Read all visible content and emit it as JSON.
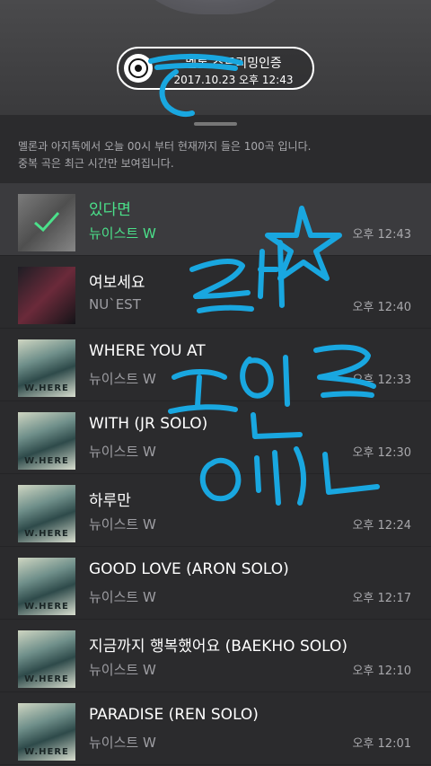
{
  "badge": {
    "title": "멜론 스트리밍인증",
    "date": "2017.10.23 오후 12:43"
  },
  "notice": {
    "line1": "멜론과 아지톡에서 오늘 00시 부터 현재까지 들은 100곡 입니다.",
    "line2": "중복 곡은 최근 시간만 보여집니다."
  },
  "songs": [
    {
      "title": "있다면",
      "artist": "뉴이스트 W",
      "time": "오후 12:43"
    },
    {
      "title": "여보세요",
      "artist": "NU`EST",
      "time": "오후 12:40"
    },
    {
      "title": "WHERE YOU AT",
      "artist": "뉴이스트 W",
      "time": "오후 12:33"
    },
    {
      "title": "WITH (JR SOLO)",
      "artist": "뉴이스트 W",
      "time": "오후 12:30"
    },
    {
      "title": "하루만",
      "artist": "뉴이스트 W",
      "time": "오후 12:24"
    },
    {
      "title": "GOOD LOVE (ARON SOLO)",
      "artist": "뉴이스트 W",
      "time": "오후 12:17"
    },
    {
      "title": "지금까지 행복했어요 (BAEKHO SOLO)",
      "artist": "뉴이스트 W",
      "time": "오후 12:10"
    },
    {
      "title": "PARADISE (REN SOLO)",
      "artist": "뉴이스트 W",
      "time": "오후 12:01"
    }
  ],
  "album_label": "W.HERE",
  "colors": {
    "accent": "#4be08a",
    "scribble": "#19a7e0"
  }
}
